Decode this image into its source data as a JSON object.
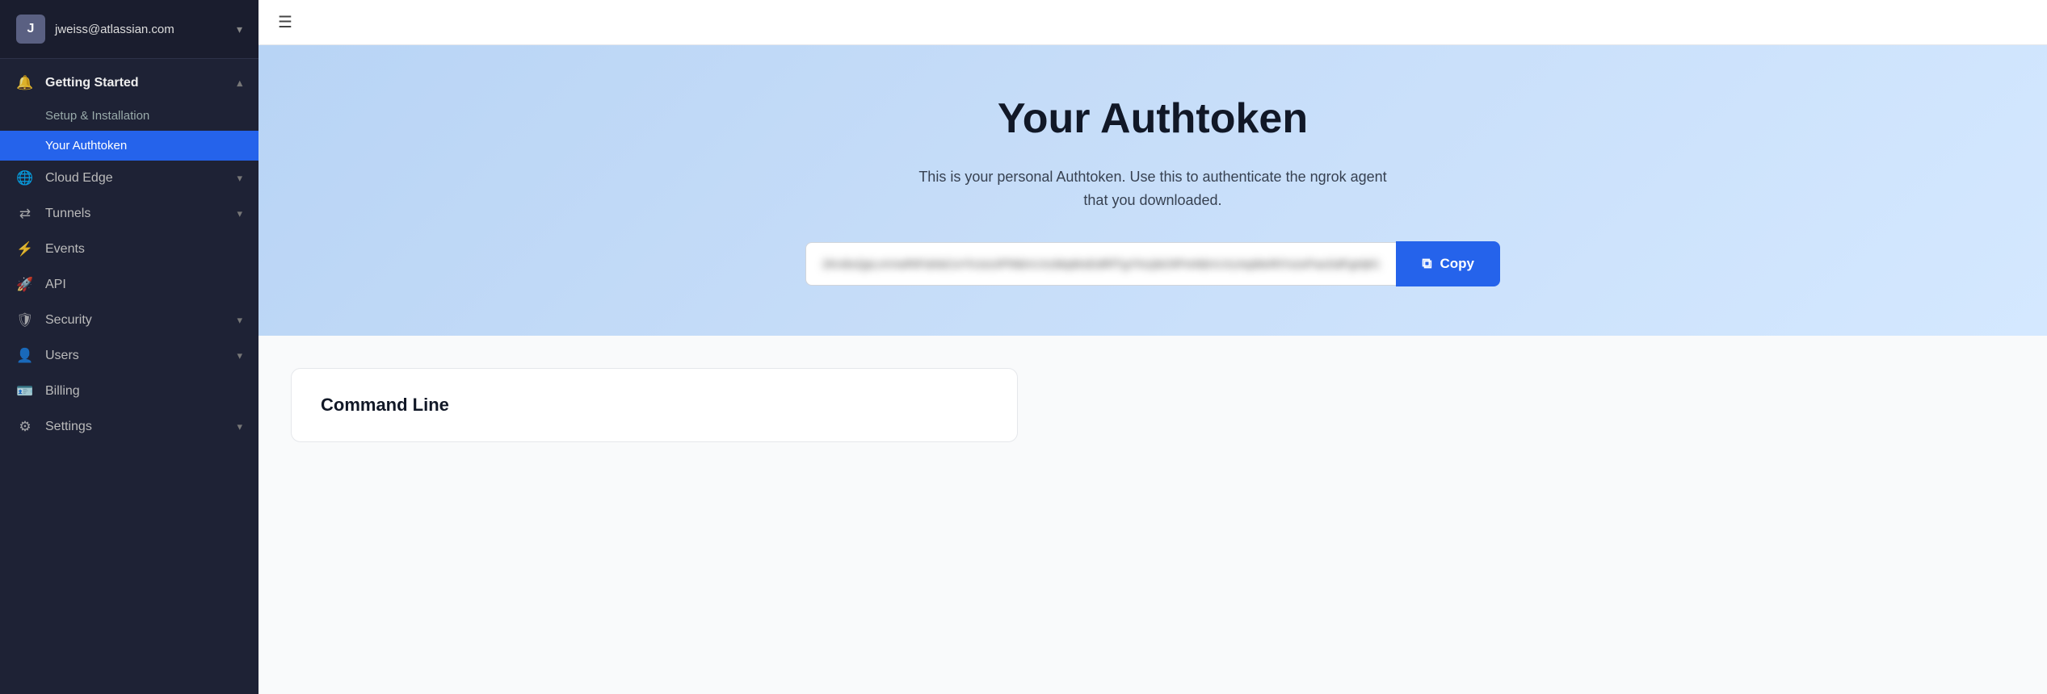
{
  "sidebar": {
    "user": {
      "email": "jweiss@atlassian.com",
      "avatar_letter": "J"
    },
    "nav": {
      "getting_started_label": "Getting Started",
      "setup_label": "Setup & Installation",
      "your_authtoken_label": "Your Authtoken",
      "cloud_edge_label": "Cloud Edge",
      "tunnels_label": "Tunnels",
      "events_label": "Events",
      "api_label": "API",
      "security_label": "Security",
      "users_label": "Users",
      "billing_label": "Billing",
      "settings_label": "Settings"
    }
  },
  "topbar": {
    "menu_icon": "☰"
  },
  "hero": {
    "title": "Your Authtoken",
    "subtitle": "This is your personal Authtoken. Use this to authenticate the ngrok agent that you downloaded.",
    "token_placeholder": "2Kn8xQpLmVwRtFdAbCeYhJoUiPlNbVcXzMqWsEdRfTgYhUjIkOlPmNbVcXzAqWeRtYuIoPasSdFgHjKlZxCvBnMmQwErTyUiOpAsDfGhJkLzXcVbNm",
    "copy_icon": "⧉",
    "copy_label": "Copy"
  },
  "content": {
    "command_line_title": "Command Line"
  }
}
